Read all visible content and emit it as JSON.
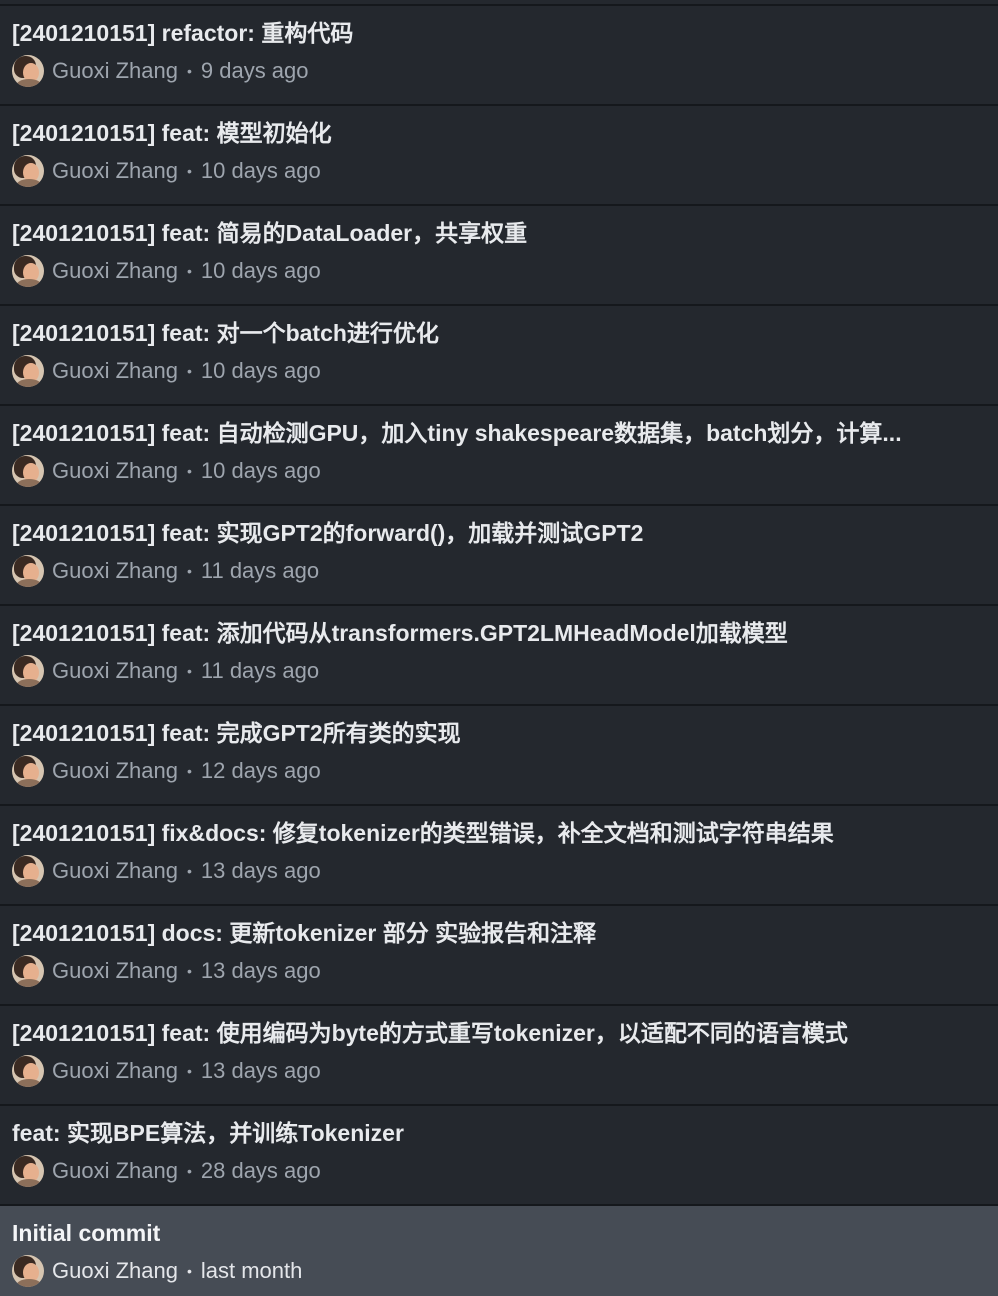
{
  "commits": [
    {
      "title": "[2401210151] refactor: 重构代码",
      "author": "Guoxi Zhang",
      "separator": "•",
      "date": "9 days ago"
    },
    {
      "title": "[2401210151] feat: 模型初始化",
      "author": "Guoxi Zhang",
      "separator": "•",
      "date": "10 days ago"
    },
    {
      "title": "[2401210151] feat: 简易的DataLoader，共享权重",
      "author": "Guoxi Zhang",
      "separator": "•",
      "date": "10 days ago"
    },
    {
      "title": "[2401210151] feat: 对一个batch进行优化",
      "author": "Guoxi Zhang",
      "separator": "•",
      "date": "10 days ago"
    },
    {
      "title": "[2401210151] feat: 自动检测GPU，加入tiny shakespeare数据集，batch划分，计算...",
      "author": "Guoxi Zhang",
      "separator": "•",
      "date": "10 days ago"
    },
    {
      "title": "[2401210151] feat: 实现GPT2的forward()，加载并测试GPT2",
      "author": "Guoxi Zhang",
      "separator": "•",
      "date": "11 days ago"
    },
    {
      "title": "[2401210151] feat: 添加代码从transformers.GPT2LMHeadModel加载模型",
      "author": "Guoxi Zhang",
      "separator": "•",
      "date": "11 days ago"
    },
    {
      "title": "[2401210151] feat: 完成GPT2所有类的实现",
      "author": "Guoxi Zhang",
      "separator": "•",
      "date": "12 days ago"
    },
    {
      "title": "[2401210151] fix&docs: 修复tokenizer的类型错误，补全文档和测试字符串结果",
      "author": "Guoxi Zhang",
      "separator": "•",
      "date": "13 days ago"
    },
    {
      "title": "[2401210151] docs: 更新tokenizer 部分 实验报告和注释",
      "author": "Guoxi Zhang",
      "separator": "•",
      "date": "13 days ago"
    },
    {
      "title": "[2401210151] feat: 使用编码为byte的方式重写tokenizer，以适配不同的语言模式",
      "author": "Guoxi Zhang",
      "separator": "•",
      "date": "13 days ago"
    },
    {
      "title": "feat: 实现BPE算法，并训练Tokenizer",
      "author": "Guoxi Zhang",
      "separator": "•",
      "date": "28 days ago"
    },
    {
      "title": "Initial commit",
      "author": "Guoxi Zhang",
      "separator": "•",
      "date": "last month"
    }
  ],
  "selected_index": 12,
  "colors": {
    "background": "#24282e",
    "selected_background": "#464c55",
    "divider": "#15181c",
    "title_text": "#e8eaed",
    "meta_text": "#9ea5ae"
  },
  "icons": {
    "avatar": "user-avatar-photo"
  }
}
